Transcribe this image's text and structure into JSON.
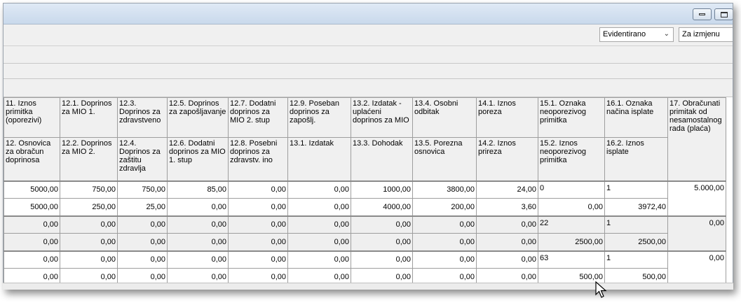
{
  "toolbar": {
    "status_select": "Evidentirano",
    "action_select": "Za izmjenu"
  },
  "grid": {
    "header_top": [
      "11. Iznos primitka (oporezivi)",
      "12.1. Doprinos za MIO 1.",
      "12.3. Doprinos za zdravstveno",
      "12.5. Doprinos za zapošljavanje",
      "12.7. Dodatni doprinos za MIO 2. stup",
      "12.9. Poseban doprinos za zapošlj.",
      "13.2. Izdatak - uplaćeni doprinos za MIO",
      "13.4. Osobni odbitak",
      "14.1. Iznos poreza",
      "15.1. Oznaka neoporezivog primitka",
      "16.1. Oznaka načina isplate",
      "17. Obračunati primitak od nesamostalnog rada (plaća)"
    ],
    "header_bottom": [
      "12. Osnovica za obračun doprinosa",
      "12.2. Doprinos za MIO 2.",
      "12.4. Doprinos za zaštitu zdravlja",
      "12.6. Dodatni doprinos za MIO 1. stup",
      "12.8. Posebni doprinos za zdravstv. ino",
      "13.1. Izdatak",
      "13.3. Dohodak",
      "13.5. Porezna osnovica",
      "14.2. Iznos prireza",
      "15.2. Iznos neoporezivog primitka",
      "16.2. Iznos isplate"
    ],
    "rows": [
      {
        "top": [
          "5000,00",
          "750,00",
          "750,00",
          "85,00",
          "0,00",
          "0,00",
          "1000,00",
          "3800,00",
          "24,00",
          "0",
          "1"
        ],
        "bottom": [
          "5000,00",
          "250,00",
          "25,00",
          "0,00",
          "0,00",
          "0,00",
          "4000,00",
          "200,00",
          "3,60",
          "0,00",
          "3972,40"
        ],
        "total": "5.000,00"
      },
      {
        "top": [
          "0,00",
          "0,00",
          "0,00",
          "0,00",
          "0,00",
          "0,00",
          "0,00",
          "0,00",
          "0,00",
          "22",
          "1"
        ],
        "bottom": [
          "0,00",
          "0,00",
          "0,00",
          "0,00",
          "0,00",
          "0,00",
          "0,00",
          "0,00",
          "0,00",
          "2500,00",
          "2500,00"
        ],
        "total": "0,00"
      },
      {
        "top": [
          "0,00",
          "0,00",
          "0,00",
          "0,00",
          "0,00",
          "0,00",
          "0,00",
          "0,00",
          "0,00",
          "63",
          "1"
        ],
        "bottom": [
          "0,00",
          "0,00",
          "0,00",
          "0,00",
          "0,00",
          "0,00",
          "0,00",
          "0,00",
          "0,00",
          "500,00",
          "500,00"
        ],
        "total": "0,00"
      }
    ]
  }
}
